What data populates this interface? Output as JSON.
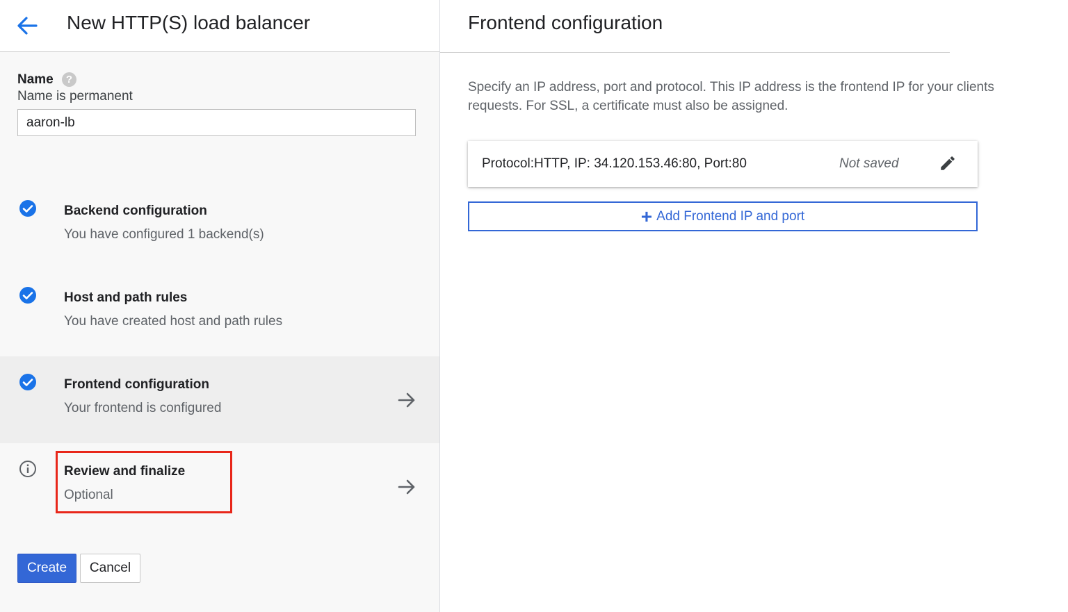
{
  "left_panel": {
    "title": "New HTTP(S) load balancer",
    "name_label": "Name",
    "name_help": "?",
    "name_hint": "Name is permanent",
    "name_value": "aaron-lb",
    "steps": [
      {
        "title": "Backend configuration",
        "subtitle": "You have configured 1 backend(s)",
        "status": "complete",
        "icon": "check-circle-icon"
      },
      {
        "title": "Host and path rules",
        "subtitle": "You have created host and path rules",
        "status": "complete",
        "icon": "check-circle-icon"
      },
      {
        "title": "Frontend configuration",
        "subtitle": "Your frontend is configured",
        "status": "complete",
        "icon": "check-circle-icon",
        "active": true
      },
      {
        "title": "Review and finalize",
        "subtitle": "Optional",
        "status": "optional",
        "icon": "info-icon"
      }
    ],
    "create_label": "Create",
    "cancel_label": "Cancel"
  },
  "right_panel": {
    "title": "Frontend configuration",
    "description": "Specify an IP address, port and protocol. This IP address is the frontend IP for your clients requests. For SSL, a certificate must also be assigned.",
    "frontend_entry": {
      "text": "Protocol:HTTP, IP: 34.120.153.46:80, Port:80",
      "status": "Not saved"
    },
    "add_button_label": "Add Frontend IP and port"
  },
  "colors": {
    "accent": "#3367d6",
    "check": "#1a73e8",
    "highlight": "#e8271a"
  }
}
